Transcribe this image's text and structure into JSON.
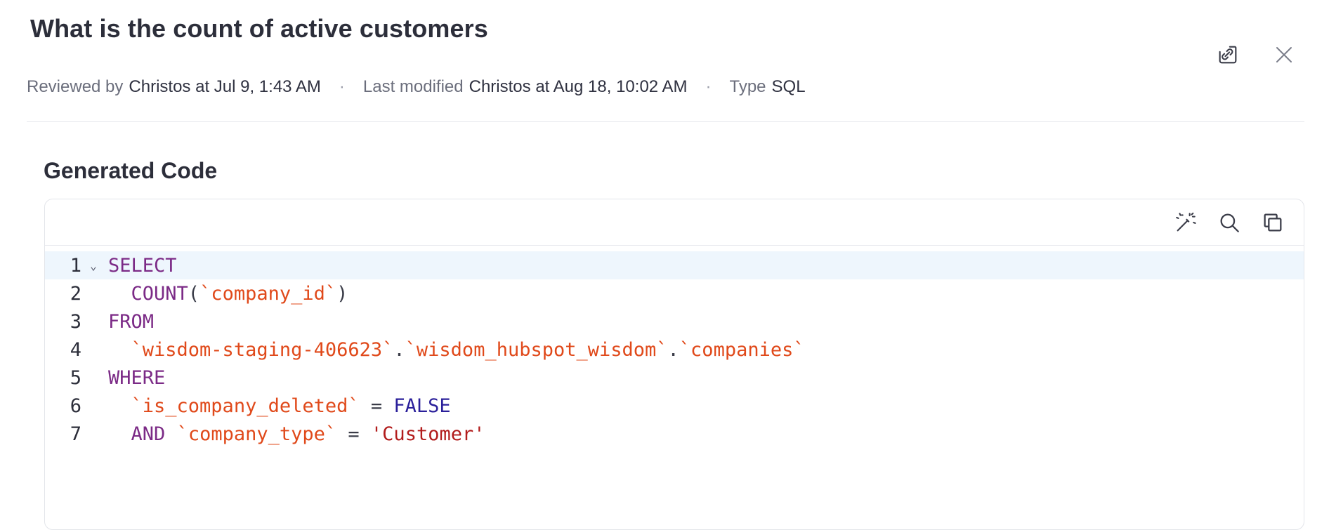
{
  "header": {
    "title": "What is the count of active customers",
    "share_icon": "link-share-icon",
    "close_icon": "close-icon"
  },
  "meta": {
    "reviewed_label": "Reviewed by",
    "reviewed_value": "Christos at Jul 9, 1:43 AM",
    "modified_label": "Last modified",
    "modified_value": "Christos at Aug 18, 10:02 AM",
    "type_label": "Type",
    "type_value": "SQL",
    "separator": "·"
  },
  "section": {
    "title": "Generated Code"
  },
  "toolbar": {
    "icons": [
      "magic-wand-icon",
      "search-icon",
      "copy-icon"
    ]
  },
  "code": {
    "language": "SQL",
    "lines": [
      {
        "n": "1",
        "tokens": [
          {
            "t": "SELECT",
            "c": "kw"
          }
        ]
      },
      {
        "n": "2",
        "tokens": [
          {
            "t": "  ",
            "c": "plain"
          },
          {
            "t": "COUNT",
            "c": "kw"
          },
          {
            "t": "(",
            "c": "plain"
          },
          {
            "t": "`company_id`",
            "c": "id"
          },
          {
            "t": ")",
            "c": "plain"
          }
        ]
      },
      {
        "n": "3",
        "tokens": [
          {
            "t": "FROM",
            "c": "kw"
          }
        ]
      },
      {
        "n": "4",
        "tokens": [
          {
            "t": "  ",
            "c": "plain"
          },
          {
            "t": "`wisdom-staging-406623`",
            "c": "id"
          },
          {
            "t": ".",
            "c": "plain"
          },
          {
            "t": "`wisdom_hubspot_wisdom`",
            "c": "id"
          },
          {
            "t": ".",
            "c": "plain"
          },
          {
            "t": "`companies`",
            "c": "id"
          }
        ]
      },
      {
        "n": "5",
        "tokens": [
          {
            "t": "WHERE",
            "c": "kw"
          }
        ]
      },
      {
        "n": "6",
        "tokens": [
          {
            "t": "  ",
            "c": "plain"
          },
          {
            "t": "`is_company_deleted`",
            "c": "id"
          },
          {
            "t": " = ",
            "c": "plain"
          },
          {
            "t": "FALSE",
            "c": "bool"
          }
        ]
      },
      {
        "n": "7",
        "tokens": [
          {
            "t": "  ",
            "c": "plain"
          },
          {
            "t": "AND",
            "c": "kw"
          },
          {
            "t": " ",
            "c": "plain"
          },
          {
            "t": "`company_type`",
            "c": "id"
          },
          {
            "t": " = ",
            "c": "plain"
          },
          {
            "t": "'Customer'",
            "c": "str"
          }
        ]
      }
    ],
    "active_line": "1",
    "fold_glyph": "⌄"
  },
  "colors": {
    "keyword": "#7b2a86",
    "identifier": "#e0491a",
    "boolean": "#2a1f9a",
    "string": "#b21c1c",
    "active_line_bg": "#eef6fd"
  }
}
